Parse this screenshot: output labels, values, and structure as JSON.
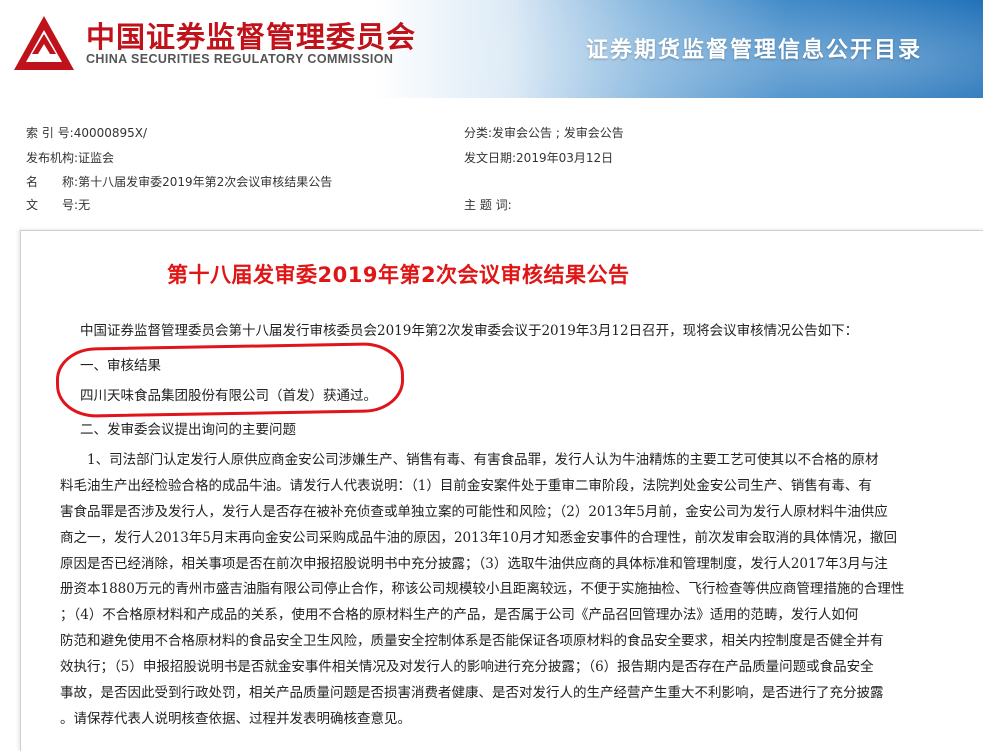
{
  "header": {
    "org_name_cn": "中国证券监督管理委员会",
    "org_name_en": "CHINA SECURITIES REGULATORY COMMISSION",
    "banner_title": "证券期货监督管理信息公开目录",
    "logo_icon": "csrc-logo-icon",
    "logo_color": "#c0121a"
  },
  "meta": {
    "index_label": "索 引 号:",
    "index_value": "40000895X/",
    "category_label": "分类:",
    "category_value": "发审会公告 ; 发审会公告",
    "issuer_label": "发布机构:",
    "issuer_value": "证监会",
    "date_label": "发文日期:",
    "date_value": "2019年03月12日",
    "name_label_1": "名",
    "name_label_2": "称:",
    "name_value": "第十八届发审委2019年第2次会议审核结果公告",
    "docno_label_1": "文",
    "docno_label_2": "号:",
    "docno_value": "无",
    "keywords_label": "主 题 词:",
    "keywords_value": ""
  },
  "article": {
    "title": "第十八届发审委2019年第2次会议审核结果公告",
    "title_color": "#e01515",
    "intro": "中国证券监督管理委员会第十八届发行审核委员会2019年第2次发审委会议于2019年3月12日召开，现将会议审核情况公告如下：",
    "section1_heading": "一、审核结果",
    "section1_result": "四川天味食品集团股份有限公司（首发）获通过。",
    "section2_heading": "二、发审委会议提出询问的主要问题",
    "question_lines": [
      "　　1、司法部门认定发行人原供应商金安公司涉嫌生产、销售有毒、有害食品罪，发行人认为牛油精炼的主要工艺可使其以不合格的原材",
      "料毛油生产出经检验合格的成品牛油。请发行人代表说明：（1）目前金安案件处于重审二审阶段，法院判处金安公司生产、销售有毒、有",
      "害食品罪是否涉及发行人，发行人是否存在被补充侦查或单独立案的可能性和风险；（2）2013年5月前，金安公司为发行人原材料牛油供应",
      "商之一，发行人2013年5月末再向金安公司采购成品牛油的原因，2013年10月才知悉金安事件的合理性，前次发审会取消的具体情况，撤回",
      "原因是否已经消除，相关事项是否在前次申报招股说明书中充分披露；（3）选取牛油供应商的具体标准和管理制度，发行人2017年3月与注",
      "册资本1880万元的青州市盛吉油脂有限公司停止合作，称该公司规模较小且距离较远，不便于实施抽检、飞行检查等供应商管理措施的合理性",
      "；（4）不合格原材料和产成品的关系，使用不合格的原材料生产的产品，是否属于公司《产品召回管理办法》适用的范畴，发行人如何",
      "防范和避免使用不合格原材料的食品安全卫生风险，质量安全控制体系是否能保证各项原材料的食品安全要求，相关内控制度是否健全并有",
      "效执行；（5）申报招股说明书是否就金安事件相关情况及对发行人的影响进行充分披露；（6）报告期内是否存在产品质量问题或食品安全",
      "事故，是否因此受到行政处罚，相关产品质量问题是否损害消费者健康、是否对发行人的生产经营产生重大不利影响，是否进行了充分披露",
      "。请保荐代表人说明核查依据、过程并发表明确核查意见。"
    ],
    "highlight_color": "#e0141b"
  }
}
